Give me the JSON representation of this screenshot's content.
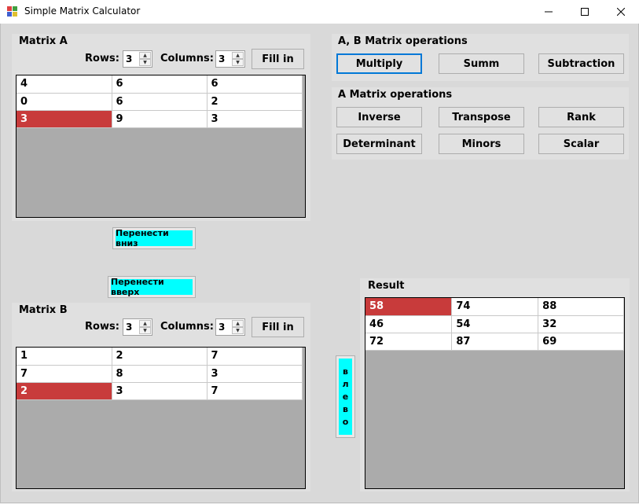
{
  "window": {
    "title": "Simple Matrix Calculator",
    "minimize": "—",
    "maximize": "☐",
    "close": "✕"
  },
  "matrix_a": {
    "title": "Matrix A",
    "rows_label": "Rows:",
    "rows_value": "3",
    "columns_label": "Columns:",
    "columns_value": "3",
    "fill_label": "Fill in",
    "cells": [
      [
        "4",
        "6",
        "6"
      ],
      [
        "0",
        "6",
        "2"
      ],
      [
        "3",
        "9",
        "3"
      ]
    ]
  },
  "matrix_b": {
    "title": "Matrix B",
    "rows_label": "Rows:",
    "rows_value": "3",
    "columns_label": "Columns:",
    "columns_value": "3",
    "fill_label": "Fill in",
    "cells": [
      [
        "1",
        "2",
        "7"
      ],
      [
        "7",
        "8",
        "3"
      ],
      [
        "2",
        "3",
        "7"
      ]
    ]
  },
  "ab_ops": {
    "title": "A, B Matrix operations",
    "multiply": "Multiply",
    "summ": "Summ",
    "subtraction": "Subtraction"
  },
  "a_ops": {
    "title": "A Matrix operations",
    "inverse": "Inverse",
    "transpose": "Transpose",
    "rank": "Rank",
    "determinant": "Determinant",
    "minors": "Minors",
    "scalar": "Scalar"
  },
  "transfer": {
    "move_down": "Перенести вниз",
    "move_up": "Перенести вверх",
    "left_letters": [
      "в",
      "л",
      "е",
      "в",
      "о"
    ]
  },
  "result": {
    "title": "Result",
    "cells": [
      [
        "58",
        "74",
        "88"
      ],
      [
        "46",
        "54",
        "32"
      ],
      [
        "72",
        "87",
        "69"
      ]
    ]
  },
  "colors": {
    "selected_cell": "#c83b3b",
    "cyan_button": "#00ffff",
    "primary_border": "#0078d7"
  }
}
